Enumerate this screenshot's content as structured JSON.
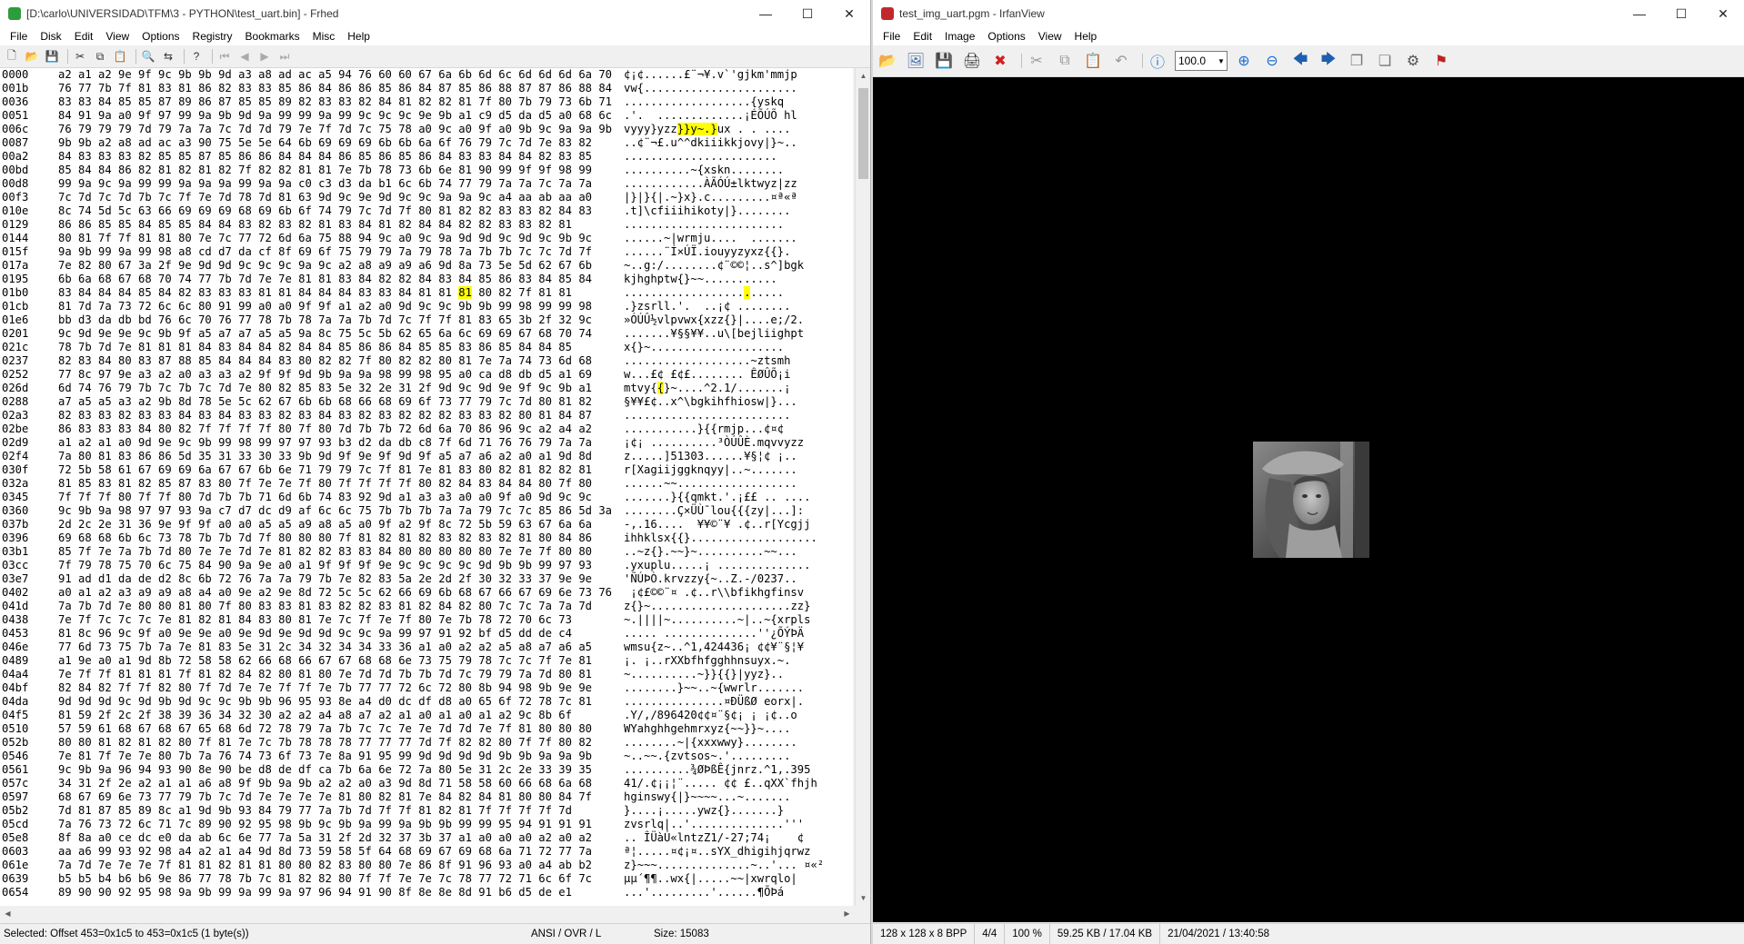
{
  "frhed": {
    "title": "[D:\\carlo\\UNIVERSIDAD\\TFM\\3 - PYTHON\\test_uart.bin] - Frhed",
    "menu": [
      "File",
      "Disk",
      "Edit",
      "View",
      "Options",
      "Registry",
      "Bookmarks",
      "Misc",
      "Help"
    ],
    "rows": [
      {
        "off": "0000",
        "hex": "a2 a1 a2 9e 9f 9c 9b 9b 9d a3 a8 ad ac a5 94 76 60 60 67 6a 6b 6d 6c 6d 6d 6d 6a 70",
        "asc": "¢¡¢......£¨­¬¥.v`'gjkm'mmjp"
      },
      {
        "off": "001b",
        "hex": "76 77 7b 7f 81 83 81 86 82 83 83 85 86 84 86 86 85 86 84 87 85 86 88 87 87 86 88 84",
        "asc": "vw{......................."
      },
      {
        "off": "0036",
        "hex": "83 83 84 85 85 87 89 86 87 85 85 89 82 83 83 82 84 81 82 82 81 7f 80 7b 79 73 6b 71",
        "asc": "...................{yskq"
      },
      {
        "off": "0051",
        "hex": "84 91 9a a0 9f 97 99 9a 9b 9d 9a 99 99 9a 99 9c 9c 9c 9e 9b a1 c9 d5 da d5 a0 68 6c",
        "asc": ".'.  .............¡ÉÕÚÕ hl"
      },
      {
        "off": "006c",
        "hex": "76 79 79 79 7d 79 7a 7a 7c 7d 7d 79 7e 7f 7d 7c 75 78 a0 9c a0 9f a0 9b 9c 9a 9a 9b",
        "asc": "vyyy}yzz|}}y~.}|ux . . ...."
      },
      {
        "off": "0087",
        "hex": "9b 9b a2 a8 ad ac a3 90 75 5e 5e 64 6b 69 69 69 6b 6b 6a 6f 76 79 7c 7d 7e 83 82",
        "asc": "..¢¨­¬£.u^^dkiiikkjovy|}~.."
      },
      {
        "off": "00a2",
        "hex": "84 83 83 83 82 85 85 87 85 86 86 84 84 84 86 85 86 85 86 84 83 83 84 84 82 83 85",
        "asc": "......................."
      },
      {
        "off": "00bd",
        "hex": "85 84 84 86 82 81 82 81 82 7f 82 82 81 81 7e 7b 78 73 6b 6e 81 90 99 9f 9f 98 99",
        "asc": "..........~{xskn........"
      },
      {
        "off": "00d8",
        "hex": "99 9a 9c 9a 99 99 9a 9a 9a 99 9a 9a c0 c3 d3 da b1 6c 6b 74 77 79 7a 7a 7c 7a 7a",
        "asc": "............ÀÃÓÚ±lktwyz|zz"
      },
      {
        "off": "00f3",
        "hex": "7c 7d 7c 7d 7b 7c 7f 7e 7d 78 7d 81 63 9d 9c 9e 9d 9c 9c 9a 9a 9c a4 aa ab aa a0",
        "asc": "|}|}{|.~}x}.c.........¤ª«ª"
      },
      {
        "off": "010e",
        "hex": "8c 74 5d 5c 63 66 69 69 69 68 69 6b 6f 74 79 7c 7d 7f 80 81 82 82 83 83 82 84 83",
        "asc": ".t]\\cfiiihikoty|}........"
      },
      {
        "off": "0129",
        "hex": "86 86 85 85 84 85 85 84 84 83 82 83 82 81 83 84 81 82 84 84 82 82 83 83 82 81",
        "asc": "........................"
      },
      {
        "off": "0144",
        "hex": "80 81 7f 7f 81 81 80 7e 7c 77 72 6d 6a 75 88 94 9c a0 9c 9a 9d 9d 9c 9d 9c 9b 9c",
        "asc": "......~|wrmju....  ......."
      },
      {
        "off": "015f",
        "hex": "9a 9b 99 9a 99 98 a8 cd d7 da cf 8f 69 6f 75 79 79 7a 79 78 7a 7b 7b 7c 7c 7d 7f",
        "asc": "......¨Í×ÚÏ.iouyyzyxz{{||}."
      },
      {
        "off": "017a",
        "hex": "7e 82 80 67 3a 2f 9e 9d 9d 9c 9c 9c 9a 9c a2 a8 a9 a9 a6 9d 8a 73 5e 5d 62 67 6b",
        "asc": "~..g:/........¢¨©©¦..s^]bgk"
      },
      {
        "off": "0195",
        "hex": "6b 6a 68 67 68 70 74 77 7b 7d 7e 7e 81 81 83 84 82 82 84 83 84 85 86 83 84 85 84",
        "asc": "kjhghptw{}~~..........."
      },
      {
        "off": "01b0",
        "hex": "83 84 84 84 85 84 82 83 83 83 81 81 84 84 84 83 83 84 81 81 |81| 80 82 7f 81 81",
        "asc": "..................|.|....."
      },
      {
        "off": "01cb",
        "hex": "81 7d 7a 73 72 6c 6c 80 91 99 a0 a0 9f 9f a1 a2 a0 9d 9c 9c 9b 9b 99 98 99 99 98",
        "asc": ".}zsrll.'.  ..¡¢ ........"
      },
      {
        "off": "01e6",
        "hex": "bb d3 da db bd 76 6c 70 76 77 78 7b 78 7a 7a 7b 7d 7c 7f 7f 81 83 65 3b 2f 32 9c",
        "asc": "»ÓÚÛ½vlpvwx{xzz{}|....e;/2."
      },
      {
        "off": "0201",
        "hex": "9c 9d 9e 9e 9c 9b 9f a5 a7 a7 a5 a5 9a 8c 75 5c 5b 62 65 6a 6c 69 69 67 68 70 74",
        "asc": ".......¥§§¥¥..u\\[bejliighpt"
      },
      {
        "off": "021c",
        "hex": "78 7b 7d 7e 81 81 81 84 83 84 84 82 84 84 85 86 86 84 85 85 83 86 85 84 84 85",
        "asc": "x{}~...................."
      },
      {
        "off": "0237",
        "hex": "82 83 84 80 83 87 88 85 84 84 84 83 80 82 82 7f 80 82 82 80 81 7e 7a 74 73 6d 68",
        "asc": "...................~ztsmh"
      },
      {
        "off": "0252",
        "hex": "77 8c 97 9e a3 a2 a0 a3 a3 a2 9f 9f 9d 9b 9a 9a 98 99 98 95 a0 ca d8 db d5 a1 69",
        "asc": "w...£¢ £¢£........ ÊØÛÕ¡i"
      },
      {
        "off": "026d",
        "hex": "6d 74 76 79 7b 7c 7b 7c 7d 7e 80 82 85 83 5e 32 2e 31 2f 9d 9c 9d 9e 9f 9c 9b a1",
        "asc": "mtvy{|{|}~....^2.1/.......¡"
      },
      {
        "off": "0288",
        "hex": "a7 a5 a5 a3 a2 9b 8d 78 5e 5c 62 67 6b 6b 68 66 68 69 6f 73 77 79 7c 7d 80 81 82",
        "asc": "§¥¥£¢..x^\\bgkihfhiosw|}..."
      },
      {
        "off": "02a3",
        "hex": "82 83 83 82 83 83 84 83 84 83 83 82 83 84 83 82 83 82 82 82 83 83 82 80 81 84 87",
        "asc": "........................."
      },
      {
        "off": "02be",
        "hex": "86 83 83 83 84 80 82 7f 7f 7f 7f 80 7f 80 7d 7b 7b 72 6d 6a 70 86 96 9c a2 a4 a2",
        "asc": "...........}{{rmjp...¢¤¢"
      },
      {
        "off": "02d9",
        "hex": "a1 a2 a1 a0 9d 9e 9c 9b 99 98 99 97 97 93 b3 d2 da db c8 7f 6d 71 76 76 79 7a 7a",
        "asc": "¡¢¡ ..........³ÒÚÛÈ.mqvvyzz"
      },
      {
        "off": "02f4",
        "hex": "7a 80 81 83 86 86 5d 35 31 33 30 33 9b 9d 9f 9e 9f 9d 9f a5 a7 a6 a2 a0 a1 9d 8d",
        "asc": "z.....]51303......¥§¦¢ ¡.."
      },
      {
        "off": "030f",
        "hex": "72 5b 58 61 67 69 69 6a 67 67 6b 6e 71 79 79 7c 7f 81 7e 81 83 80 82 81 82 82 81",
        "asc": "r[Xagiijggknqyy|..~......."
      },
      {
        "off": "032a",
        "hex": "81 85 83 81 82 85 87 83 80 7f 7e 7e 7f 80 7f 7f 7f 7f 80 82 84 83 84 84 80 7f 80",
        "asc": "......~~.................."
      },
      {
        "off": "0345",
        "hex": "7f 7f 7f 80 7f 7f 80 7d 7b 7b 71 6d 6b 74 83 92 9d a1 a3 a3 a0 a0 9f a0 9d 9c 9c",
        "asc": ".......}{{qmkt.'.¡££ .. ...."
      },
      {
        "off": "0360",
        "hex": "9c 9b 9a 98 97 97 93 9a c7 d7 dc d9 af 6c 6c 75 7b 7b 7b 7a 7a 79 7c 7c 85 86 5d 3a",
        "asc": "........Ç×ÜÙ¯lou{{{zy|...]:"
      },
      {
        "off": "037b",
        "hex": "2d 2c 2e 31 36 9e 9f 9f a0 a0 a5 a5 a9 a8 a5 a0 9f a2 9f 8c 72 5b 59 63 67 6a 6a",
        "asc": "-,.16....  ¥¥©¨¥ .¢..r[Ycgjj"
      },
      {
        "off": "0396",
        "hex": "69 68 68 6b 6c 73 78 7b 7b 7d 7f 80 80 80 7f 81 82 81 82 83 82 83 82 81 80 84 86",
        "asc": "ihhklsx{{}..................."
      },
      {
        "off": "03b1",
        "hex": "85 7f 7e 7a 7b 7d 80 7e 7e 7d 7e 81 82 82 83 83 84 80 80 80 80 80 7e 7e 7f 80 80",
        "asc": "..~z{}.~~}~..........~~..."
      },
      {
        "off": "03cc",
        "hex": "7f 79 78 75 70 6c 75 84 90 9a 9e a0 a1 9f 9f 9f 9e 9c 9c 9c 9c 9d 9b 9b 99 97 93",
        "asc": ".yxuplu.....¡ .............."
      },
      {
        "off": "03e7",
        "hex": "91 ad d1 da de d2 8c 6b 72 76 7a 7a 79 7b 7e 82 83 5a 2e 2d 2f 30 32 33 37 9e 9e",
        "asc": "'­ÑÚÞÒ.krvzzy{~..Z.-/0237.."
      },
      {
        "off": "0402",
        "hex": "a0 a1 a2 a3 a9 a9 a8 a4 a0 9e a2 9e 8d 72 5c 5c 62 66 69 6b 68 67 66 67 69 6e 73 76",
        "asc": " ¡¢£©©¨¤ .¢..r\\\\bfikhgfinsv"
      },
      {
        "off": "041d",
        "hex": "7a 7b 7d 7e 80 80 81 80 7f 80 83 83 81 83 82 82 83 81 82 84 82 80 7c 7c 7a 7a 7d",
        "asc": "z{}~.....................||zz}"
      },
      {
        "off": "0438",
        "hex": "7e 7f 7c 7c 7c 7e 81 82 81 84 83 80 81 7e 7c 7f 7e 7f 80 7e 7b 78 72 70 6c 73",
        "asc": "~.||||~..........~|..~{xrpls"
      },
      {
        "off": "0453",
        "hex": "81 8c 96 9c 9f a0 9e 9e a0 9e 9d 9e 9d 9d 9c 9c 9a 99 97 91 92 bf d5 dd de c4",
        "asc": "..... ..............''¿ÕÝÞÄ"
      },
      {
        "off": "046e",
        "hex": "77 6d 73 75 7b 7a 7e 81 83 5e 31 2c 34 32 34 34 33 36 a1 a0 a2 a2 a5 a8 a7 a6 a5",
        "asc": "wmsu{z~..^1,424436¡ ¢¢¥¨§¦¥"
      },
      {
        "off": "0489",
        "hex": "a1 9e a0 a1 9d 8b 72 58 58 62 66 68 66 67 67 68 68 6e 73 75 79 78 7c 7c 7f 7e 81",
        "asc": "¡. ¡..rXXbfhfgghhnsuyx||.~."
      },
      {
        "off": "04a4",
        "hex": "7e 7f 7f 81 81 81 7f 81 82 84 82 80 81 80 7e 7d 7d 7b 7b 7d 7c 79 79 7a 7d 80 81",
        "asc": "~..........~}}{{}|yyz}.."
      },
      {
        "off": "04bf",
        "hex": "82 84 82 7f 7f 82 80 7f 7d 7e 7e 7f 7f 7e 7b 77 77 72 6c 72 80 8b 94 98 9b 9e 9e",
        "asc": "........}~~..~{wwrlr......."
      },
      {
        "off": "04da",
        "hex": "9d 9d 9d 9c 9d 9b 9d 9c 9c 9b 9b 96 95 93 8e a4 d0 dc df d8 a0 65 6f 72 78 7c 81",
        "asc": "...............¤ÐÜßØ eorx|."
      },
      {
        "off": "04f5",
        "hex": "81 59 2f 2c 2f 38 39 36 34 32 30 a2 a2 a4 a8 a7 a2 a1 a0 a1 a0 a1 a2 9c 8b 6f",
        "asc": ".Y/,/896420¢¢¤¨§¢¡ ¡ ¡¢..o"
      },
      {
        "off": "0510",
        "hex": "57 59 61 68 67 68 67 65 68 6d 72 78 79 7a 7b 7c 7c 7e 7e 7d 7d 7e 7f 81 80 80 80",
        "asc": "WYahghhgehmrxyz{||~~}}~...."
      },
      {
        "off": "052b",
        "hex": "80 80 81 82 81 82 80 7f 81 7e 7c 7b 78 78 78 77 77 77 7d 7f 82 82 80 7f 7f 80 82",
        "asc": "........~|{xxxwwy}........"
      },
      {
        "off": "0546",
        "hex": "7e 81 7f 7e 7e 80 7b 7a 76 74 73 6f 73 7e 8a 91 95 99 9d 9d 9d 9d 9b 9b 9a 9a 9b",
        "asc": "~..~~.{zvtsos~.'........."
      },
      {
        "off": "0561",
        "hex": "9c 9b 9a 96 94 93 90 8e 90 be d8 de df ca 7b 6a 6e 72 7a 80 5e 31 2c 2e 33 39 35",
        "asc": "..........¾ØÞßÊ{jnrz.^1,.395"
      },
      {
        "off": "057c",
        "hex": "34 31 2f 2e a2 a1 a1 a6 a8 9f 9b 9a 9b a2 a2 a0 a3 9d 8d 71 58 58 60 66 68 6a 68",
        "asc": "41/.¢¡¡¦¨..... ¢¢ £..qXX`fhjh"
      },
      {
        "off": "0597",
        "hex": "68 67 69 6e 73 77 79 7b 7c 7d 7e 7e 7e 7e 81 80 82 81 7e 84 82 84 81 80 80 84 7f",
        "asc": "hginswy{|}~~~~...~......."
      },
      {
        "off": "05b2",
        "hex": "7d 81 87 85 89 8c a1 9d 9b 93 84 79 77 7a 7b 7d 7f 7f 81 82 81 7f 7f 7f 7f 7d",
        "asc": "}....¡.....ywz{}.......}"
      },
      {
        "off": "05cd",
        "hex": "7a 76 73 72 6c 71 7c 89 90 92 95 98 9b 9c 9b 9a 99 9a 9b 9b 99 99 95 94 91 91 91",
        "asc": "zvsrlq|..'..............'''"
      },
      {
        "off": "05e8",
        "hex": "8f 8a a0 ce dc e0 da ab 6c 6e 77 7a 5a 31 2f 2d 32 37 3b 37 a1 a0 a0 a0 a2 a0 a2",
        "asc": ".. ÎÜàÚ«lntzZ1/-27;74¡    ¢"
      },
      {
        "off": "0603",
        "hex": "aa a6 99 93 92 98 a4 a2 a1 a4 9d 8d 73 59 58 5f 64 68 69 67 69 68 6a 71 72 77 7a",
        "asc": "ª¦.....¤¢¡¤..sYX_dhigihjqrwz"
      },
      {
        "off": "061e",
        "hex": "7a 7d 7e 7e 7e 7f 81 81 82 81 81 80 80 82 83 80 80 7e 86 8f 91 96 93 a0 a4 ab b2",
        "asc": "z}~~~..............~..'... ¤«²"
      },
      {
        "off": "0639",
        "hex": "b5 b5 b4 b6 b6 9e 86 77 78 7b 7c 81 82 82 80 7f 7f 7e 7e 7c 78 77 72 71 6c 6f 7c",
        "asc": "µµ´¶¶..wx{|.....~~|xwrqlo|"
      },
      {
        "off": "0654",
        "hex": "89 90 90 92 95 98 9a 9b 99 9a 99 9a 97 96 94 91 90 8f 8e 8e 8d 91 b6 d5 de e1",
        "asc": "...'.........'......¶ÕÞá"
      }
    ],
    "status": {
      "selection": "Selected: Offset 453=0x1c5 to 453=0x1c5 (1 byte(s))",
      "mode": "ANSI / OVR / L",
      "size": "Size: 15083"
    }
  },
  "irfan": {
    "title": "test_img_uart.pgm - IrfanView",
    "menu": [
      "File",
      "Edit",
      "Image",
      "Options",
      "View",
      "Help"
    ],
    "zoom": "100.0",
    "status": {
      "dims": "128 x 128 x 8 BPP",
      "page": "4/4",
      "zoom": "100 %",
      "size": "59.25 KB / 17.04 KB",
      "date": "21/04/2021 / 13:40:58"
    }
  },
  "colors": {
    "highlight": "#ffff00",
    "viewer_bg": "#000000"
  }
}
